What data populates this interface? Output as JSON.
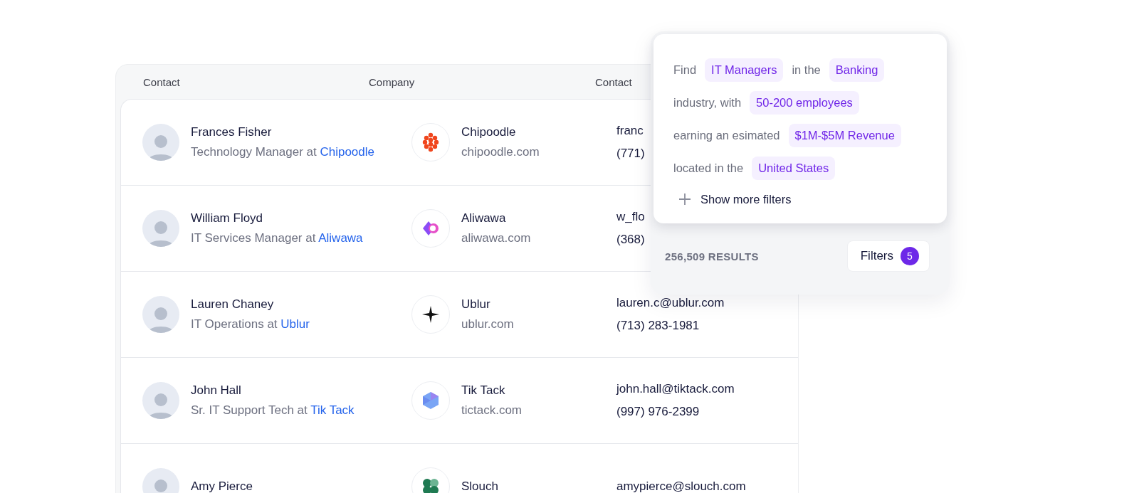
{
  "table": {
    "columns": [
      "Contact",
      "Company",
      "Contact"
    ],
    "rows": [
      {
        "name": "Frances Fisher",
        "role": "Technology Manager at **Chipoodle**",
        "company": "Chipoodle",
        "domain": "chipoodle.com",
        "kind": "dots",
        "email": "franc",
        "phone": "(771)"
      },
      {
        "name": "William Floyd",
        "role": "IT Services Manager at **Aliwawa**",
        "company": "Aliwawa",
        "domain": "aliwawa.com",
        "kind": "pill",
        "email": "w_flo",
        "phone": "(368)"
      },
      {
        "name": "Lauren Chaney",
        "role": "IT Operations at **Ublur**",
        "company": "Ublur",
        "domain": "ublur.com",
        "kind": "star",
        "email": "lauren.c@ublur.com",
        "phone": "(713) 283-1981"
      },
      {
        "name": "John Hall",
        "role": "Sr. IT Support Tech at **Tik Tack**",
        "company": "Tik Tack",
        "domain": "tictack.com",
        "kind": "gem",
        "email": "john.hall@tiktack.com",
        "phone": "(997) 976-2399"
      },
      {
        "name": "Amy Pierce",
        "company": "Slouch",
        "kind": "clover",
        "email": "amypierce@slouch.com"
      }
    ]
  },
  "filter_panel": {
    "lines": [
      [
        {
          "kind": "text",
          "text": "Find"
        },
        {
          "kind": "chip",
          "text": "IT Managers"
        },
        {
          "kind": "text",
          "text": "in the"
        },
        {
          "kind": "chip",
          "text": "Banking"
        }
      ],
      [
        {
          "kind": "text",
          "text": "industry, with"
        },
        {
          "kind": "chip",
          "text": "50-200 employees"
        }
      ],
      [
        {
          "kind": "text",
          "text": "earning an esimated"
        },
        {
          "kind": "chip",
          "text": "$1M-$5M Revenue"
        }
      ],
      [
        {
          "kind": "text",
          "text": "located in the"
        },
        {
          "kind": "chip",
          "text": "United States"
        }
      ]
    ],
    "more": "Show more filters",
    "results": "256,509 RESULTS",
    "filters_button": "Filters",
    "filters_count": "5"
  }
}
